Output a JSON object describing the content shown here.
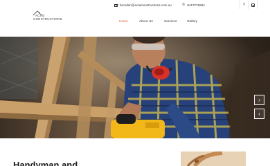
{
  "brand": {
    "line1": "ACAD",
    "line2": "CONSTRUCTIONS"
  },
  "contact": {
    "email": "brendan@acadconstructions.com.au",
    "phone": "0417276664"
  },
  "social": {
    "facebook_glyph": "f"
  },
  "nav": [
    {
      "label": "Home",
      "active": true
    },
    {
      "label": "About Us",
      "active": false
    },
    {
      "label": "Services",
      "active": false
    },
    {
      "label": "Gallery",
      "active": false
    }
  ],
  "slider": {
    "next_glyph": "›",
    "prev_glyph": "‹"
  },
  "intro": {
    "heading": "Handyman and"
  },
  "colors": {
    "accent": "#e05a1b",
    "text": "#333333"
  },
  "icons": [
    "envelope-icon",
    "phone-icon",
    "facebook-icon",
    "instagram-icon",
    "chevron-right-icon",
    "chevron-left-icon"
  ]
}
